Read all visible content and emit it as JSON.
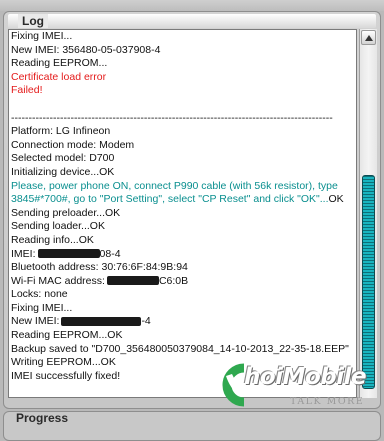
{
  "log": {
    "title": "Log",
    "lines": [
      {
        "text": "Fixing IMEI...",
        "color": "#111111"
      },
      {
        "text": "New IMEI: 356480-05-037908-4",
        "color": "#111111"
      },
      {
        "text": "Reading EEPROM...",
        "color": "#111111"
      },
      {
        "text": "Certificate load error",
        "color": "#e41b1b"
      },
      {
        "text": "Failed!",
        "color": "#e41b1b"
      },
      {
        "text": "",
        "color": "#111111"
      },
      {
        "text": "--------------------------------------------------------------------------------------------",
        "color": "#111111"
      },
      {
        "text": "Platform: LG Infineon",
        "color": "#111111"
      },
      {
        "text": "Connection mode: Modem",
        "color": "#111111"
      },
      {
        "text": "Selected model: D700",
        "color": "#111111"
      },
      {
        "text": "Initializing device...OK",
        "color": "#111111"
      },
      {
        "text": "Please, power phone ON, connect P990 cable (with 56k resistor), type",
        "color": "#0a8f8f"
      },
      {
        "text": "3845#*700#, go to \"Port Setting\", select \"CP Reset\" and click \"OK\"...",
        "color": "#0a8f8f",
        "suffix": "OK"
      },
      {
        "text": "Sending preloader...OK",
        "color": "#111111"
      },
      {
        "text": "Sending loader...OK",
        "color": "#111111"
      },
      {
        "text": "Reading info...OK",
        "color": "#111111"
      },
      {
        "text": "IMEI:",
        "redact_width": 62,
        "after": "08-4",
        "color": "#111111"
      },
      {
        "text": "Bluetooth address: 30:76:6F:84:9B:94",
        "color": "#111111"
      },
      {
        "text": "Wi-Fi MAC address:",
        "redact_width": 52,
        "after": "C6:0B",
        "color": "#111111"
      },
      {
        "text": "Locks: none",
        "color": "#111111"
      },
      {
        "text": "Fixing IMEI...",
        "color": "#111111"
      },
      {
        "text": "New IMEI:",
        "redact_width": 80,
        "after": "-4",
        "color": "#111111"
      },
      {
        "text": "Reading EEPROM...OK",
        "color": "#111111"
      },
      {
        "text": "Backup saved to \"D700_356480050379084_14-10-2013_22-35-18.EEP\"",
        "color": "#111111"
      },
      {
        "text": "Writing EEPROM...OK",
        "color": "#111111"
      },
      {
        "text": "IMEI successfully fixed!",
        "color": "#111111"
      }
    ]
  },
  "progress": {
    "title": "Progress"
  },
  "watermark": {
    "brand": "hoiMobile",
    "logo_letter": "C",
    "tagline": "TALK MORE",
    "accent": "#2fa84f"
  },
  "scrollbar": {
    "up_icon": "arrow-up-icon",
    "down_icon": "arrow-down-icon",
    "thumb_color": "#19b4bf"
  }
}
